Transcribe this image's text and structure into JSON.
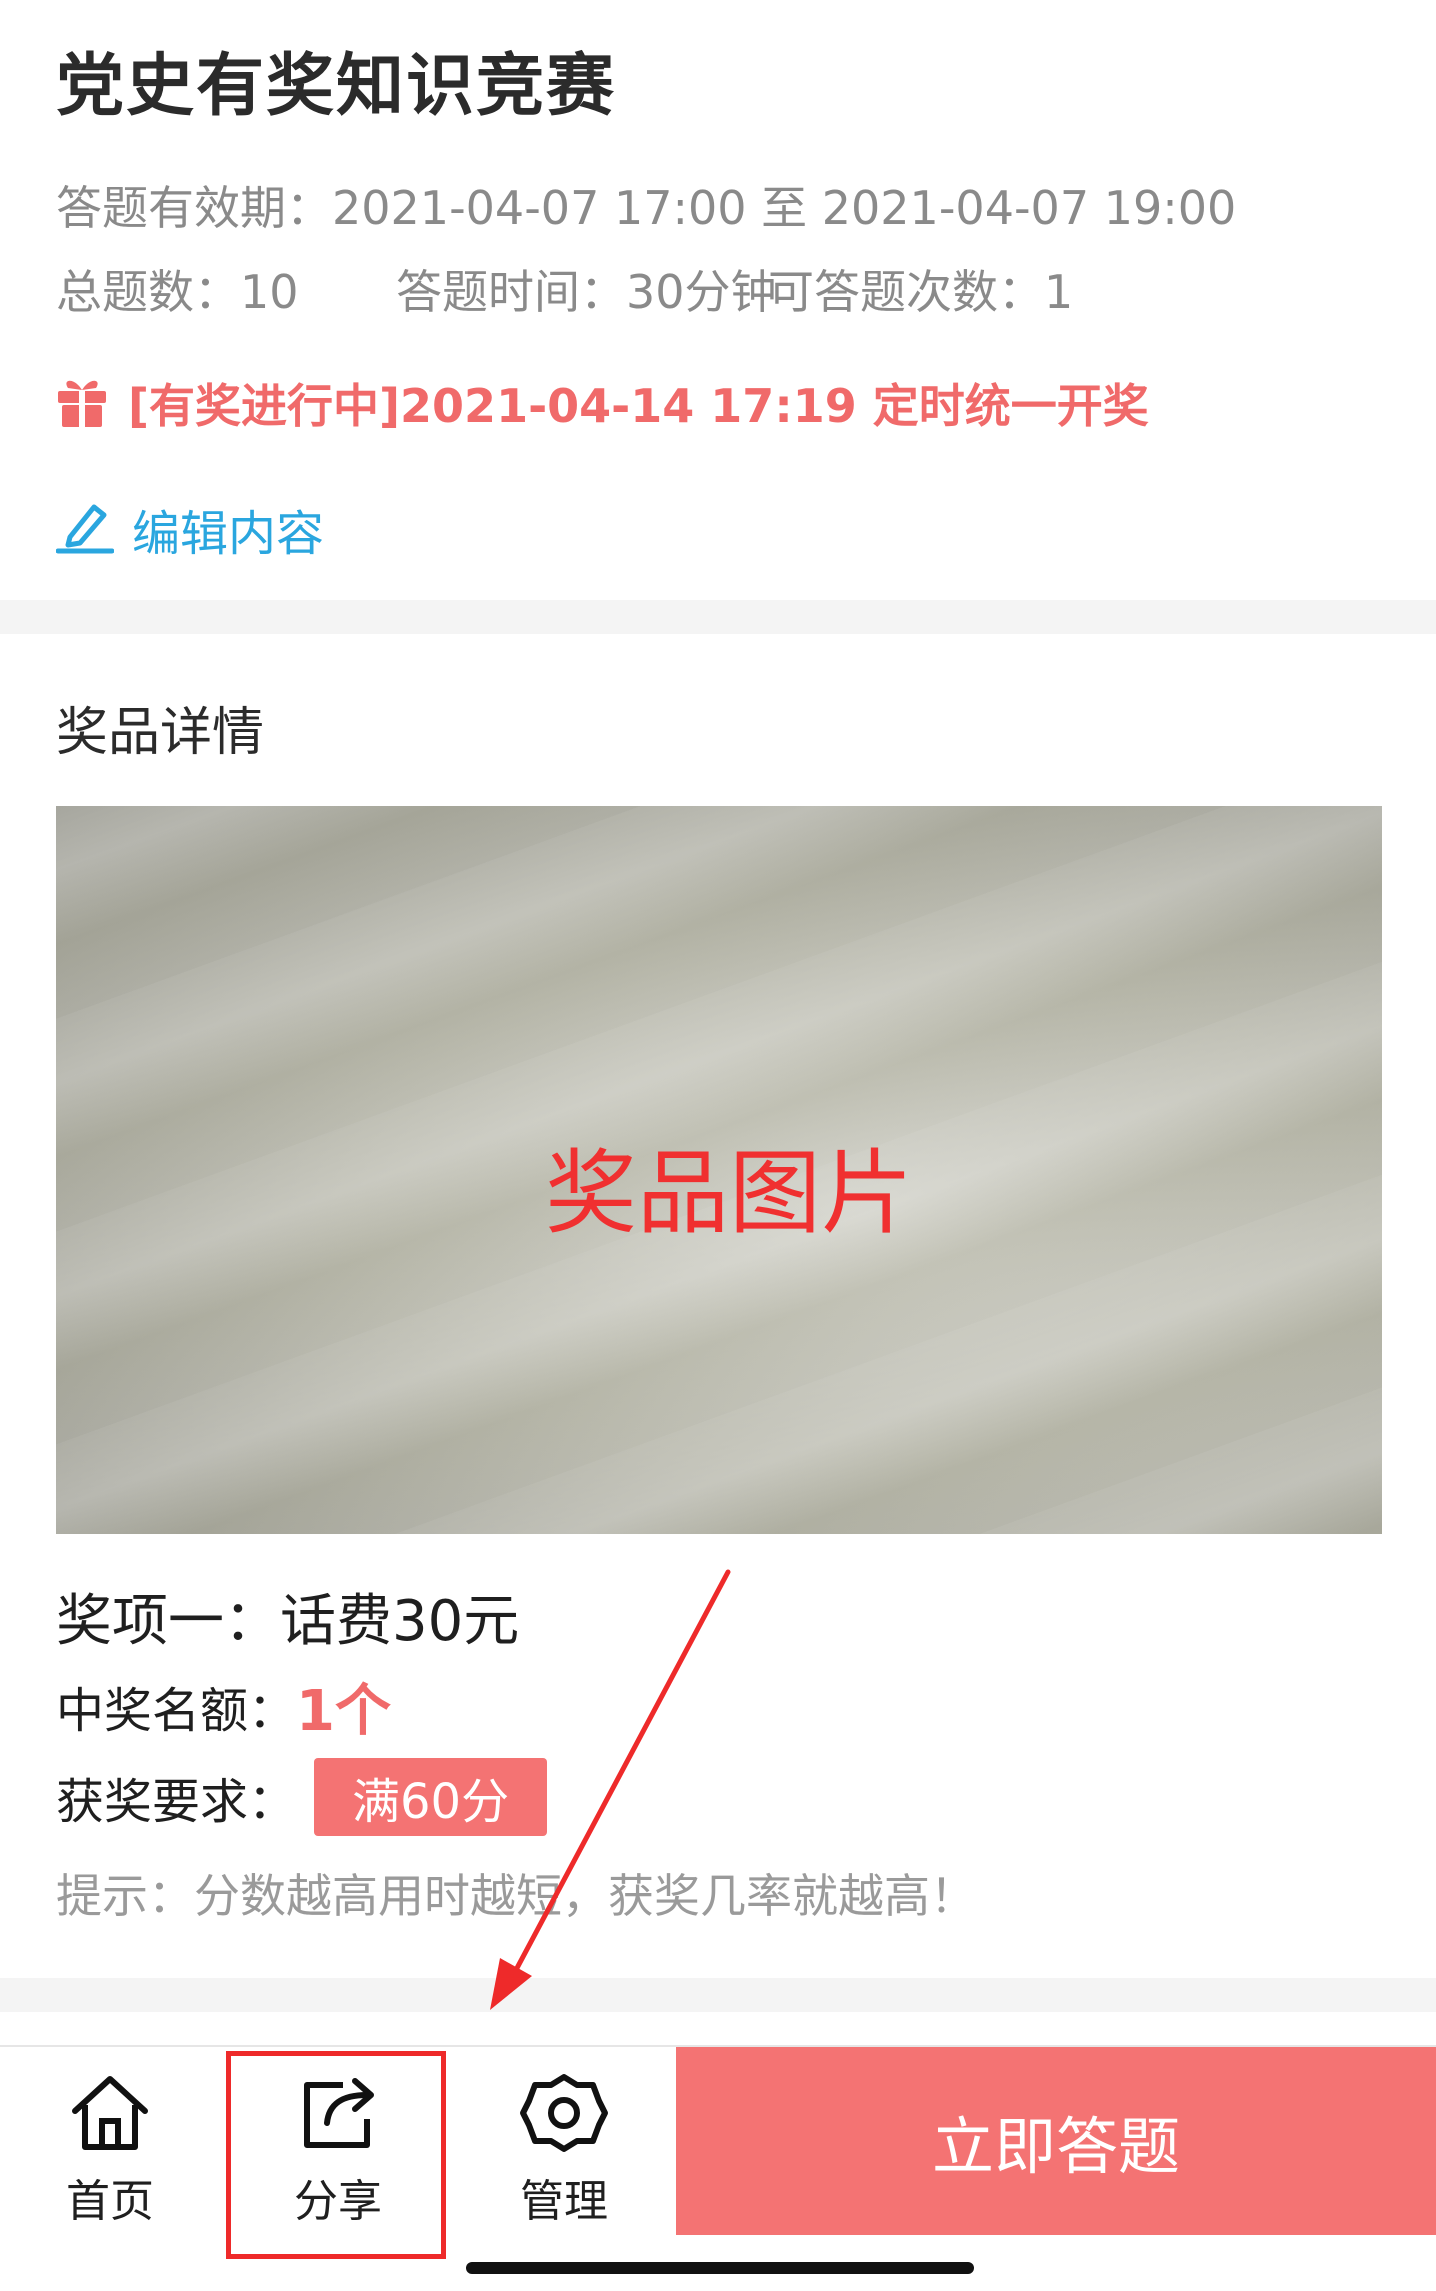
{
  "header": {
    "title": "党史有奖知识竞赛",
    "valid_period": "答题有效期：2021-04-07 17:00 至 2021-04-07 19:00",
    "total_questions": "总题数：10",
    "answer_time": "答题时间：30分钟",
    "attempts": "可答题次数：1",
    "prize_status": "[有奖进行中]2021-04-14 17:19 定时统一开奖",
    "edit_label": "编辑内容"
  },
  "prize": {
    "heading": "奖品详情",
    "image_caption": "奖品图片",
    "item": "奖项一：话费30元",
    "quota_label": "中奖名额：",
    "quota_value": "1个",
    "requirement_label": "获奖要求：",
    "requirement_value": "满60分",
    "tip": "提示：分数越高用时越短，获奖几率就越高！"
  },
  "tabbar": {
    "home_label": "首页",
    "share_label": "分享",
    "manage_label": "管理",
    "start_label": "立即答题"
  },
  "colors": {
    "accent_red": "#f47373",
    "status_red": "#f06a6a",
    "link_blue": "#2aa6df",
    "annotation_red": "#ee2a2a"
  },
  "icons": [
    "gift-icon",
    "edit-pen-icon",
    "home-icon",
    "share-icon",
    "gear-icon"
  ]
}
